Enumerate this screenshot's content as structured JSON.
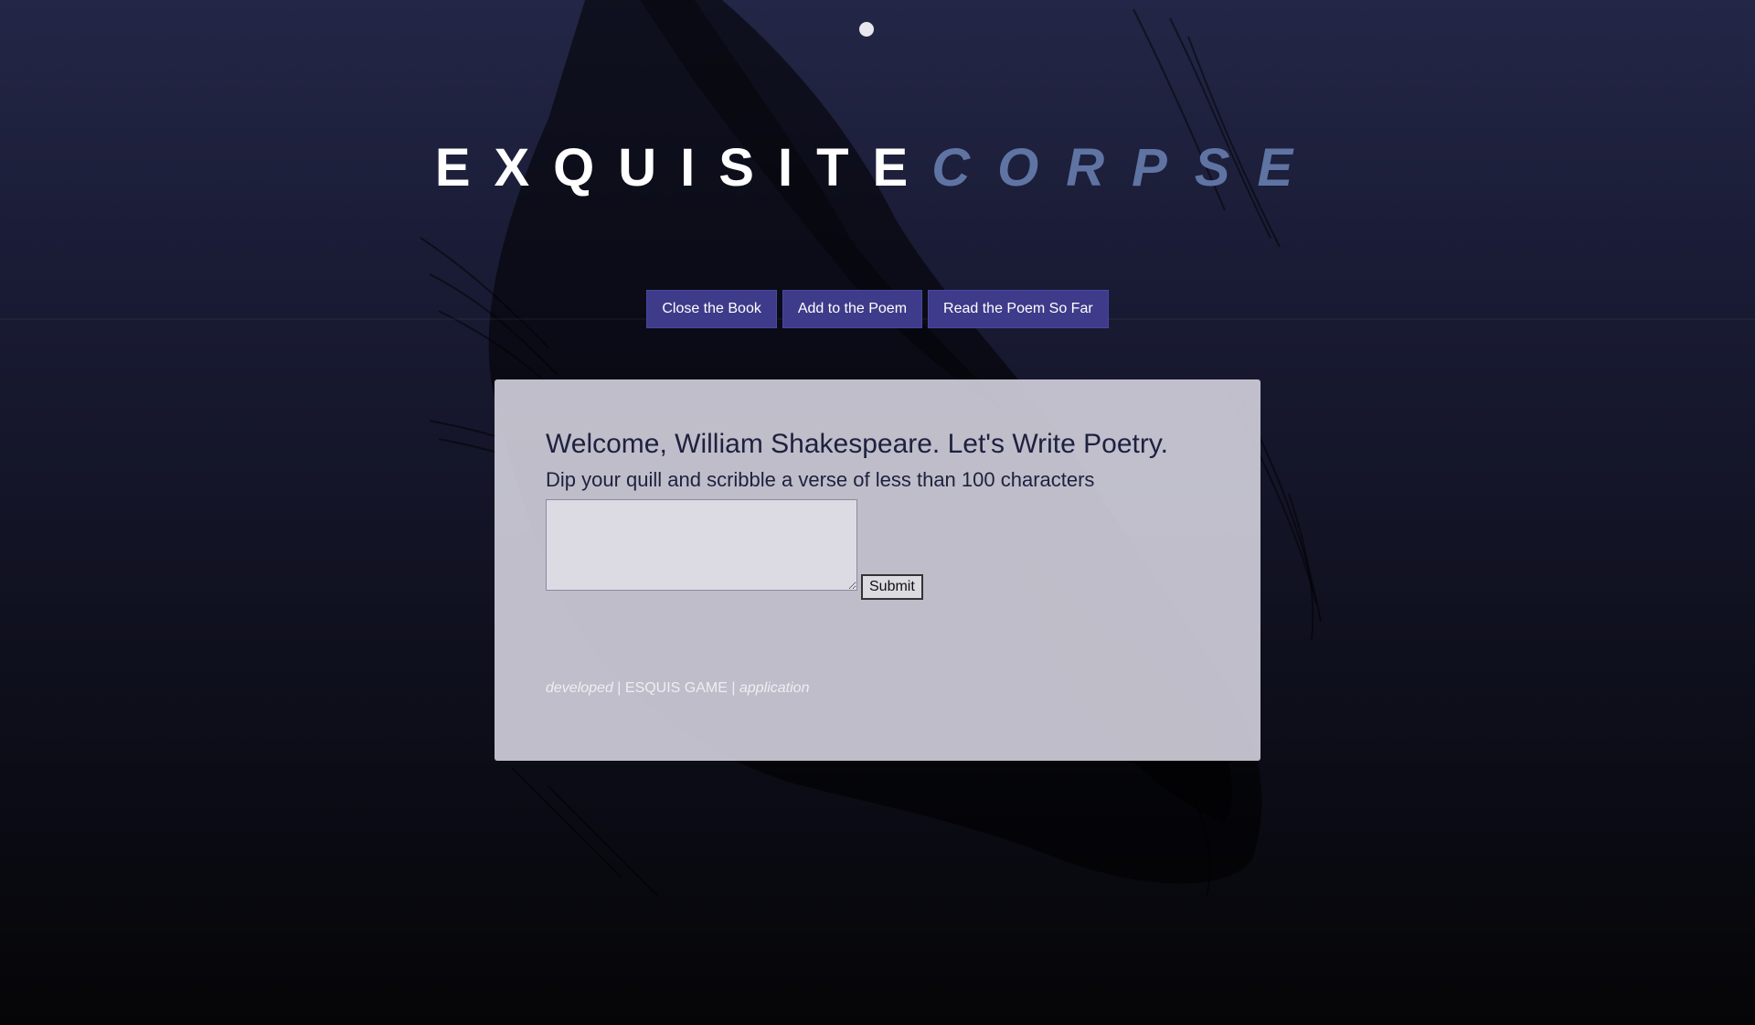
{
  "header": {
    "title_part1": "EXQUISITE",
    "title_part2": "CORPSE"
  },
  "nav": {
    "close_label": "Close the Book",
    "add_label": "Add to the Poem",
    "read_label": "Read the Poem So Far"
  },
  "panel": {
    "welcome": "Welcome, William Shakespeare. Let's Write Poetry.",
    "instruction": "Dip your quill and scribble a verse of less than 100 characters",
    "verse_value": "",
    "submit_label": "Submit"
  },
  "footer": {
    "developed": "developed",
    "separator1": " | ",
    "game": "ESQUIS GAME",
    "separator2": " | ",
    "application": "application"
  },
  "colors": {
    "background_top": "#232646",
    "background_bottom": "#050507",
    "title_primary": "#ffffff",
    "title_accent": "#5f74a3",
    "nav_button": "#3e3b8a",
    "panel": "#d4d2de",
    "text_dark": "#1e2140"
  },
  "icons": {
    "moon": "moon-dot-icon",
    "background_art": "crow-illustration"
  }
}
